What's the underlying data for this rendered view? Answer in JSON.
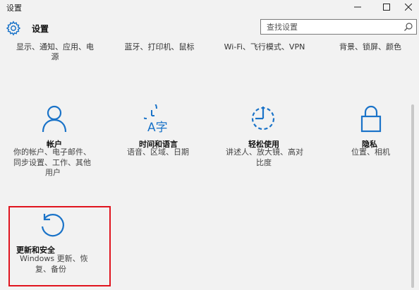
{
  "window": {
    "title": "设置"
  },
  "header": {
    "title": "设置",
    "search_placeholder": "查找设置"
  },
  "top_row": [
    {
      "desc_line1": "显示、通知、应用、电",
      "desc_line2": "源"
    },
    {
      "desc_line1": "蓝牙、打印机、鼠标"
    },
    {
      "desc_line1": "Wi-Fi、飞行模式、VPN"
    },
    {
      "desc_line1": "背景、锁屏、颜色"
    }
  ],
  "tiles": {
    "accounts": {
      "label": "帐户",
      "desc_lines": [
        "你的帐户、电子邮件、",
        "同步设置、工作、其他",
        "用户"
      ]
    },
    "time_language": {
      "label": "时间和语言",
      "desc_lines": [
        "语音、区域、日期"
      ]
    },
    "ease_of_access": {
      "label": "轻松使用",
      "desc_lines": [
        "讲述人、放大镜、高对",
        "比度"
      ]
    },
    "privacy": {
      "label": "隐私",
      "desc_lines": [
        "位置、相机"
      ]
    },
    "update_security": {
      "label": "更新和安全",
      "desc_lines": [
        "Windows 更新、恢",
        "复、备份"
      ]
    }
  },
  "colors": {
    "accent": "#1a73c8",
    "highlight_border": "#e0141e"
  },
  "icons": {
    "time_language_glyph": "A字"
  }
}
